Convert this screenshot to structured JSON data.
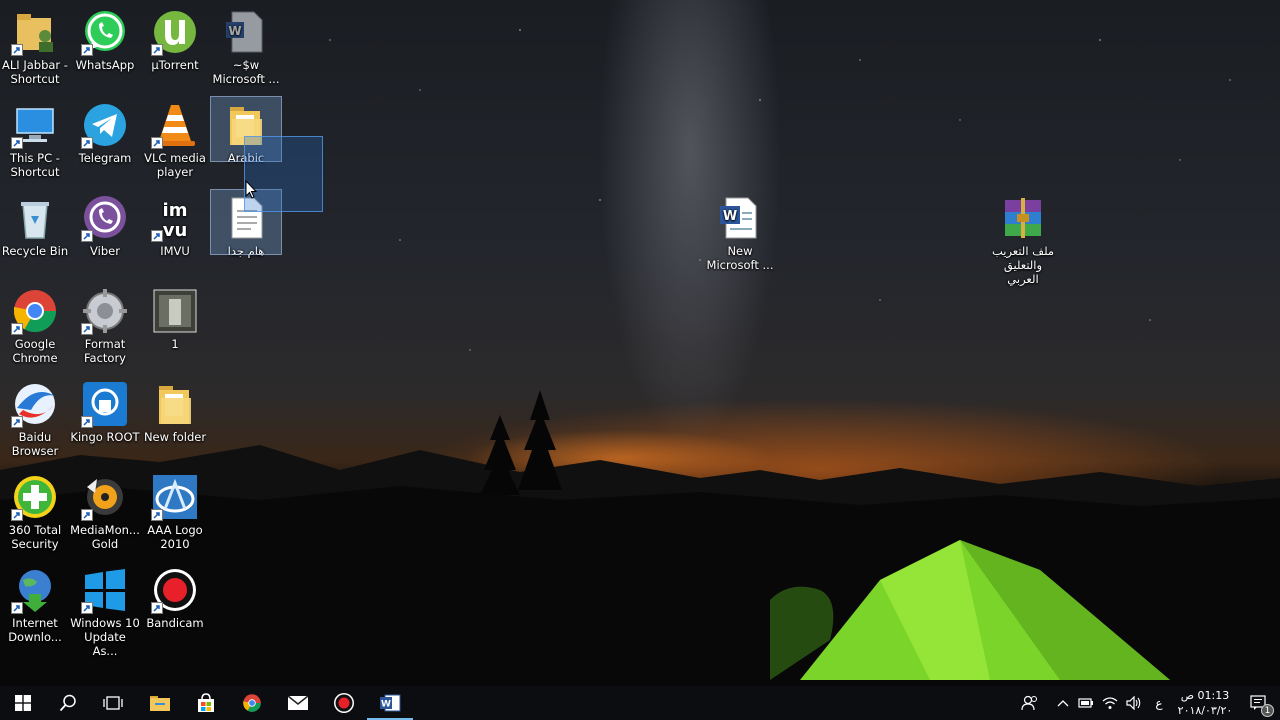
{
  "desktop": {
    "icons": {
      "ali_jabbar": "ALI Jabbar - Shortcut",
      "whatsapp": "WhatsApp",
      "utorrent": "µTorrent",
      "word_temp": "~$w Microsoft ...",
      "this_pc": "This PC - Shortcut",
      "telegram": "Telegram",
      "vlc": "VLC media player",
      "arabic_folder": "Arabic",
      "recycle_bin": "Recycle Bin",
      "viber": "Viber",
      "imvu": "IMVU",
      "important_file": "هام جدا",
      "chrome": "Google Chrome",
      "format_factory": "Format Factory",
      "image_1": "1",
      "baidu": "Baidu Browser",
      "kingo": "Kingo ROOT",
      "new_folder": "New folder",
      "security_360": "360 Total Security",
      "mediamonkey": "MediaMon... Gold",
      "aaa_logo": "AAA Logo 2010",
      "idm": "Internet Downlo...",
      "win10_update": "Windows 10 Update As...",
      "bandicam": "Bandicam",
      "new_word_doc": "New Microsoft ...",
      "rar_file": "ملف التعريب والتعليق العربي"
    }
  },
  "taskbar": {
    "language": "ع",
    "time": "01:13 ص",
    "date": "٢٠١٨/٠٣/٢٠",
    "notification_count": "1",
    "colors": {
      "accent": "#0078d7",
      "taskbar_bg": "#0c0e12"
    }
  }
}
